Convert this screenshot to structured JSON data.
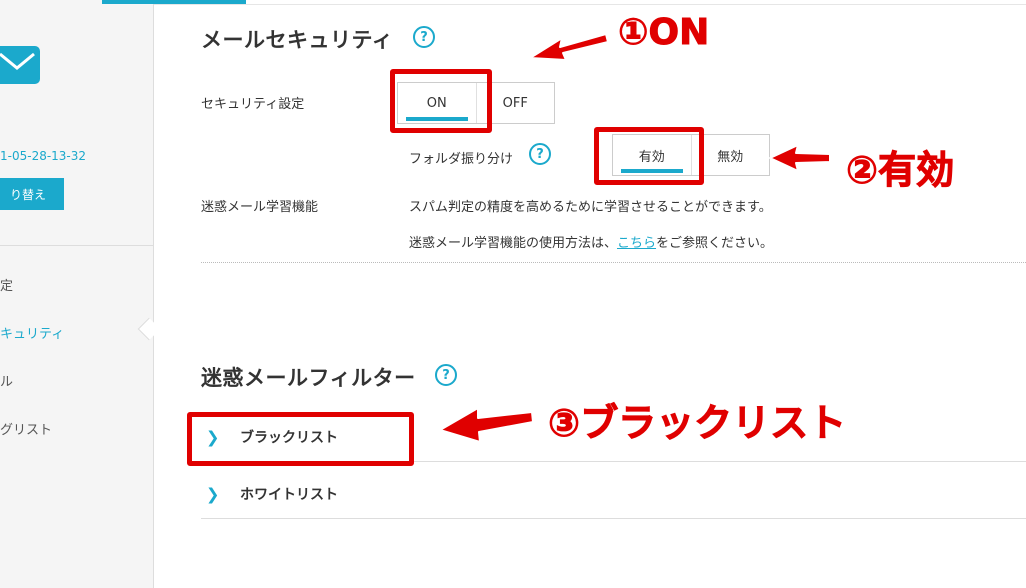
{
  "sidebar": {
    "account_date": "1-05-28-13-32",
    "switch_label": "り替え",
    "items": [
      {
        "label": "定",
        "active": false
      },
      {
        "label": "キュリティ",
        "active": true
      },
      {
        "label": "ル",
        "active": false
      },
      {
        "label": "グリスト",
        "active": false
      }
    ]
  },
  "security": {
    "title": "メールセキュリティ",
    "help": "?",
    "setting_label": "セキュリティ設定",
    "toggle": {
      "on": "ON",
      "off": "OFF",
      "selected": "ON"
    },
    "folder_label": "フォルダ振り分け",
    "folder_help": "?",
    "folder_toggle": {
      "enabled": "有効",
      "disabled": "無効",
      "selected": "有効"
    },
    "learning_label": "迷惑メール学習機能",
    "learning_text": "スパム判定の精度を高めるために学習させることができます。",
    "learning_howto_prefix": "迷惑メール学習機能の使用方法は、",
    "learning_howto_link": "こちら",
    "learning_howto_suffix": "をご参照ください。"
  },
  "filter": {
    "title": "迷惑メールフィルター",
    "help": "?",
    "items": [
      {
        "label": "ブラックリスト"
      },
      {
        "label": "ホワイトリスト"
      }
    ]
  },
  "annotations": {
    "step1": "①ON",
    "step2": "②有効",
    "step3": "③ブラックリスト",
    "color": "#e00000"
  },
  "colors": {
    "accent": "#1ba9cc"
  }
}
